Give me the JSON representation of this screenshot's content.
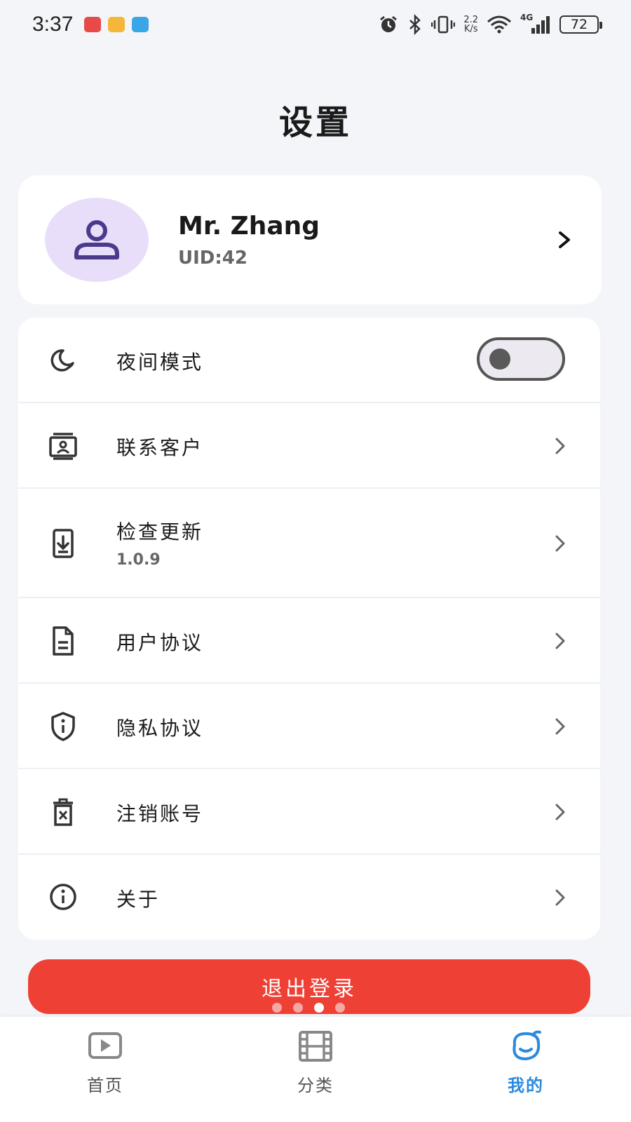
{
  "status_bar": {
    "time": "3:37",
    "net_speed_top": "2.2",
    "net_speed_bottom": "K/s",
    "signal_label": "4G",
    "battery": "72"
  },
  "page": {
    "title": "设置"
  },
  "profile": {
    "name": "Mr. Zhang",
    "uid": "UID:42"
  },
  "settings": {
    "night_mode": {
      "label": "夜间模式",
      "enabled": false
    },
    "contact_support": {
      "label": "联系客户"
    },
    "check_update": {
      "label": "检查更新",
      "version": "1.0.9"
    },
    "user_agreement": {
      "label": "用户协议"
    },
    "privacy_policy": {
      "label": "隐私协议"
    },
    "delete_account": {
      "label": "注销账号"
    },
    "about": {
      "label": "关于"
    }
  },
  "logout": {
    "label": "退出登录"
  },
  "bottom_nav": {
    "items": [
      {
        "label": "首页",
        "icon": "play-tv-icon"
      },
      {
        "label": "分类",
        "icon": "film-icon"
      },
      {
        "label": "我的",
        "icon": "mascot-icon"
      }
    ],
    "active_index": 2
  },
  "colors": {
    "accent": "#2a8ae0",
    "logout": "#ef4036",
    "avatar_bg": "#e8defa",
    "avatar_icon": "#4b3a8c"
  }
}
